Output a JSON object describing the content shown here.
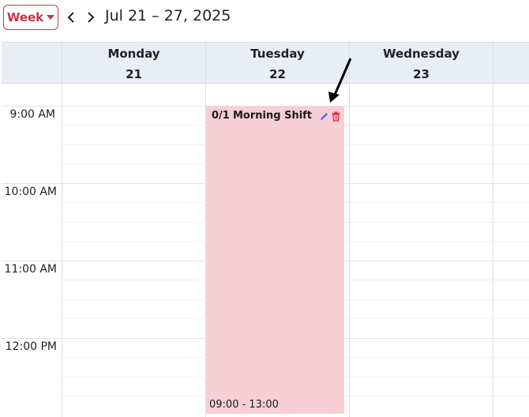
{
  "toolbar": {
    "view_label": "Week",
    "date_range": "Jul 21 – 27, 2025"
  },
  "days": [
    {
      "name": "Monday",
      "number": "21"
    },
    {
      "name": "Tuesday",
      "number": "22"
    },
    {
      "name": "Wednesday",
      "number": "23"
    }
  ],
  "times": [
    "9:00 AM",
    "10:00 AM",
    "11:00 AM",
    "12:00 PM"
  ],
  "event": {
    "count": "0/1",
    "title": "Morning Shift",
    "time_range": "09:00 - 13:00"
  },
  "colors": {
    "accent": "#c0394b",
    "event_bg": "#f6cfd6",
    "header_bg": "#e9edf4",
    "edit_icon": "#5a6fd8",
    "delete_icon": "#d9364f"
  },
  "icons": {
    "prev": "chevron-left-icon",
    "next": "chevron-right-icon",
    "dropdown": "caret-down-icon",
    "edit": "pencil-icon",
    "delete": "trash-icon",
    "annotation": "arrow-icon"
  }
}
